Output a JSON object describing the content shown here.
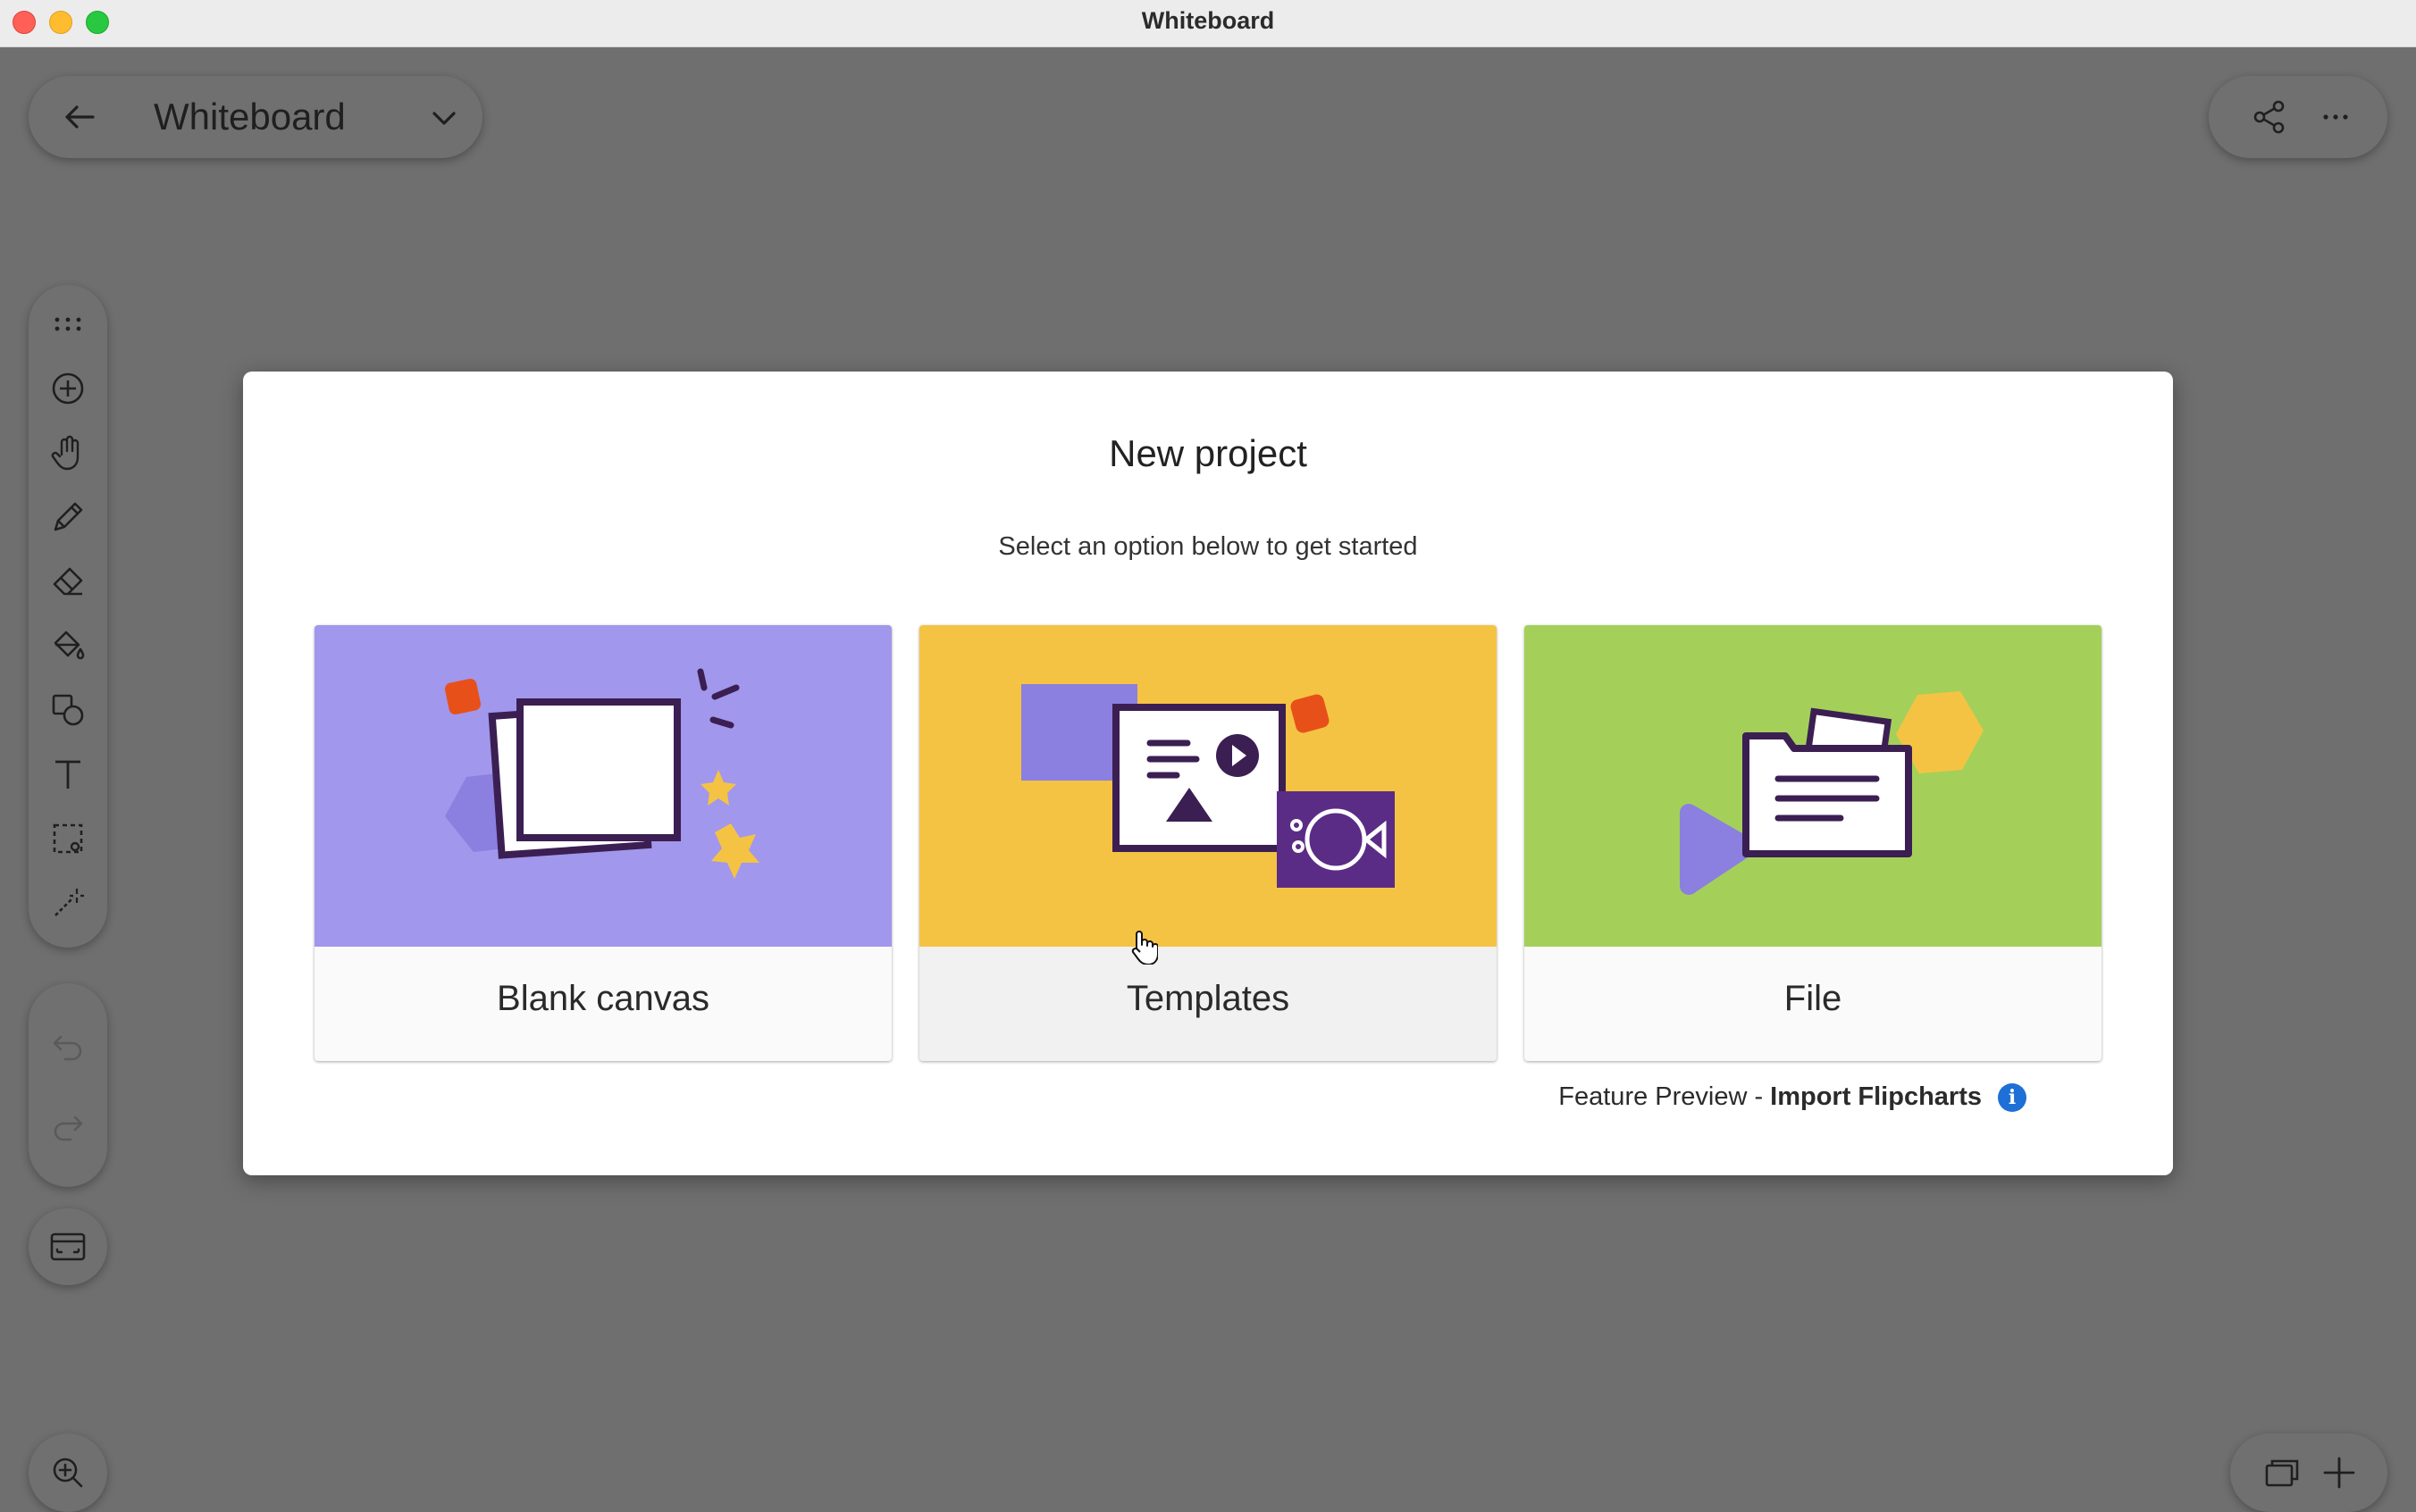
{
  "window": {
    "title": "Whiteboard"
  },
  "header": {
    "board_name": "Whiteboard"
  },
  "toolbar": {
    "tools": [
      "drag-handle-icon",
      "add-icon",
      "hand-pan-icon",
      "pen-icon",
      "eraser-icon",
      "fill-bucket-icon",
      "shapes-icon",
      "text-icon",
      "lasso-select-icon",
      "laser-pointer-icon"
    ],
    "history": [
      "undo-icon",
      "redo-icon"
    ]
  },
  "modal": {
    "title": "New project",
    "subtitle": "Select an option below to get started",
    "options": [
      {
        "label": "Blank canvas",
        "color": "#a197ec"
      },
      {
        "label": "Templates",
        "color": "#f5c343"
      },
      {
        "label": "File",
        "color": "#a4d05a"
      }
    ],
    "feature_prefix": "Feature Preview -",
    "feature_link": "Import Flipcharts"
  },
  "colors": {
    "overlay": "#6f6f6f",
    "info": "#1e6fd6",
    "purple_dark": "#3b1f52",
    "orange": "#e8501a"
  }
}
